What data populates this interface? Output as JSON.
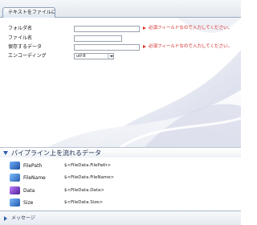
{
  "tab": {
    "label": "テキストをファイルに..."
  },
  "form": {
    "rows": [
      {
        "label": "フォルダ名",
        "value": "",
        "required_text": "必須フィールドなので入力してください。",
        "type": "text"
      },
      {
        "label": "ファイル名",
        "value": "",
        "required_text": "",
        "type": "text"
      },
      {
        "label": "保存するデータ",
        "value": "",
        "required_text": "必須フィールドなので入力してください。",
        "type": "text"
      },
      {
        "label": "エンコーディング",
        "value": "utf-8",
        "required_text": "",
        "type": "select"
      }
    ]
  },
  "pipeline": {
    "title": "パイプライン上を流れるデータ",
    "items": [
      {
        "name": "FilePath",
        "value": "$<FileData.FilePath>",
        "color": "#2d6fc4"
      },
      {
        "name": "FileName",
        "value": "$<FileData.FileName>",
        "color": "#3b7fd0"
      },
      {
        "name": "Data",
        "value": "$<FileData.Data>",
        "color": "#6a3fb0"
      },
      {
        "name": "Size",
        "value": "$<FileData.Size>",
        "color": "#2f78c8"
      }
    ]
  },
  "message": {
    "title": "メッセージ"
  },
  "colors": {
    "required": "#d02020",
    "accent": "#2e5fa8"
  }
}
